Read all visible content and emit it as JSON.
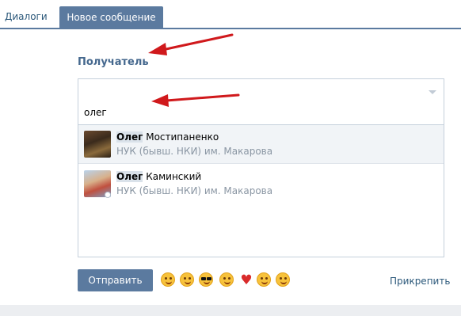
{
  "tabs": {
    "dialogs_label": "Диалоги",
    "new_message_label": "Новое сообщение"
  },
  "recipient": {
    "label": "Получатель",
    "input_value": "олег"
  },
  "suggestions": [
    {
      "highlight": "Олег",
      "rest": " Мостипаненко",
      "subtitle": "НУК (бывш. НКИ) им. Макарова"
    },
    {
      "highlight": "Олег",
      "rest": " Каминский",
      "subtitle": "НУК (бывш. НКИ) им. Макарова"
    }
  ],
  "actions": {
    "send_label": "Отправить",
    "attach_label": "Прикрепить"
  },
  "emojis": [
    "kiss-emoji-icon",
    "wink-emoji-icon",
    "sunglasses-emoji-icon",
    "grin-emoji-icon",
    "heart-icon",
    "smile-emoji-icon",
    "tongue-emoji-icon"
  ],
  "colors": {
    "accent": "#5b7a9f",
    "label": "#45688e",
    "link": "#2b587a",
    "annotation_arrow": "#d0191c"
  }
}
